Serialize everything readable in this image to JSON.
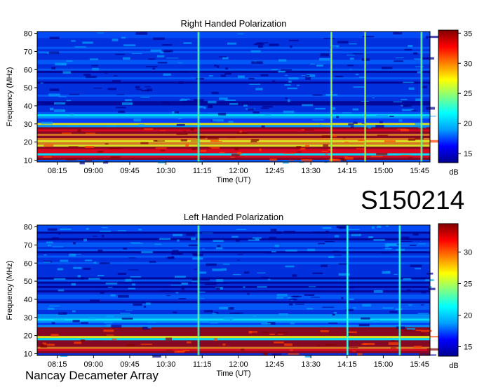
{
  "chart_data": [
    {
      "type": "heatmap",
      "title": "Right Handed Polarization",
      "xlabel": "Time (UT)",
      "ylabel": "Frequency (MHz)",
      "x_ticks": [
        "08:15",
        "09:00",
        "09:45",
        "10:30",
        "11:15",
        "12:00",
        "12:45",
        "13:30",
        "14:15",
        "15:00",
        "15:45"
      ],
      "y_ticks": [
        10,
        20,
        30,
        40,
        50,
        60,
        70,
        80
      ],
      "xlim": [
        "07:50",
        "15:58"
      ],
      "ylim": [
        9,
        81
      ],
      "colorbar": {
        "unit": "dB",
        "ticks": [
          15,
          20,
          25,
          30,
          35
        ],
        "range": [
          13.5,
          35.5
        ]
      },
      "strong_emission_bands_mhz": [
        [
          10,
          28
        ]
      ],
      "bright_vertical_bursts_ut": [
        "11:10",
        "13:55",
        "14:37",
        "15:47"
      ]
    },
    {
      "type": "heatmap",
      "title": "Left Handed Polarization",
      "xlabel": "Time (UT)",
      "ylabel": "Frequency (MHz)",
      "x_ticks": [
        "08:15",
        "09:00",
        "09:45",
        "10:30",
        "11:15",
        "12:00",
        "12:45",
        "13:30",
        "14:15",
        "15:00",
        "15:45"
      ],
      "y_ticks": [
        10,
        20,
        30,
        40,
        50,
        60,
        70,
        80
      ],
      "xlim": [
        "07:50",
        "15:58"
      ],
      "ylim": [
        9,
        81
      ],
      "colorbar": {
        "unit": "dB",
        "ticks": [
          15,
          20,
          25,
          30
        ],
        "range": [
          13.5,
          34.5
        ]
      },
      "strong_emission_bands_mhz": [
        [
          10,
          24
        ]
      ],
      "bright_vertical_bursts_ut": [
        "11:10",
        "14:15",
        "15:20"
      ]
    }
  ],
  "header": {
    "observation_id": "S150214"
  },
  "footer": {
    "observatory": "Nancay Decameter Array"
  },
  "colormap": [
    "#00008f",
    "#0000ff",
    "#00a0ff",
    "#00ffff",
    "#80ff80",
    "#ffff00",
    "#ff8000",
    "#ff0000",
    "#800000"
  ]
}
